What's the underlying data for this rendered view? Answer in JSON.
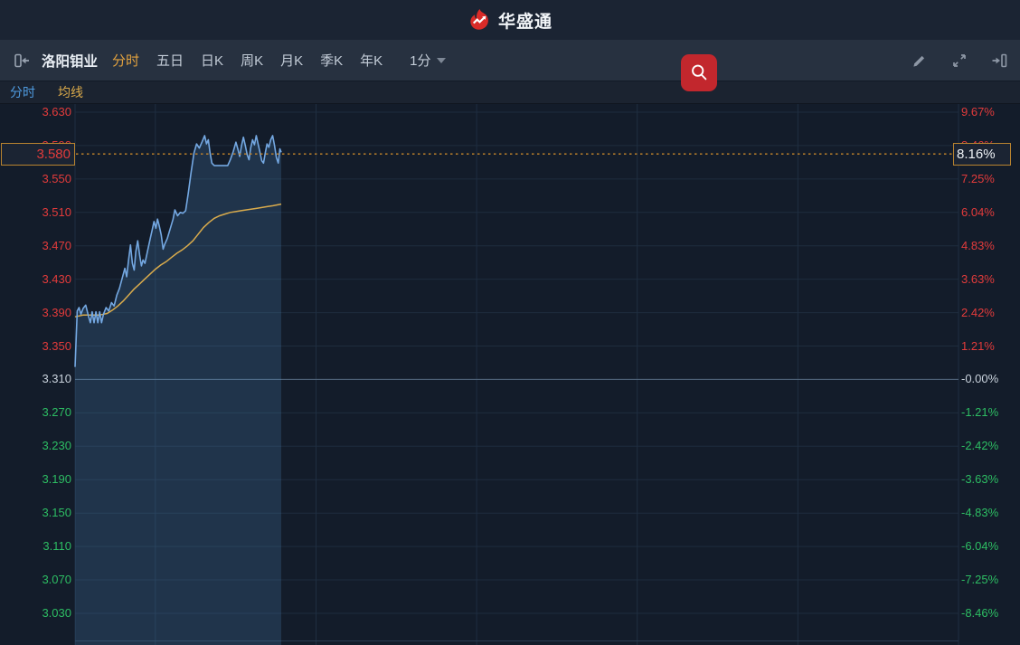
{
  "header": {
    "app_name": "华盛通"
  },
  "toolbar": {
    "stock_name": "洛阳钼业",
    "period_tabs": [
      {
        "label": "分时",
        "active": true
      },
      {
        "label": "五日",
        "active": false
      },
      {
        "label": "日K",
        "active": false
      },
      {
        "label": "周K",
        "active": false
      },
      {
        "label": "月K",
        "active": false
      },
      {
        "label": "季K",
        "active": false
      },
      {
        "label": "年K",
        "active": false
      }
    ],
    "interval_label": "1分",
    "icons": [
      "collapse-panel-icon",
      "search-icon",
      "draw-icon",
      "fullscreen-icon",
      "exit-panel-icon",
      "chevron-down-icon"
    ]
  },
  "subtabs": [
    {
      "label": "分时",
      "color": "#4f9be0"
    },
    {
      "label": "均线",
      "color": "#d9a94a"
    }
  ],
  "palette": {
    "up_red": "#e23b3b",
    "down_green": "#2dbd63",
    "neutral": "#c9d2dc",
    "accent_orange": "#e2a23f",
    "dotted_line": "#c8872b",
    "search_red": "#c2272d",
    "logo_red": "#d92b28"
  },
  "chart_data": {
    "type": "line",
    "title": "洛阳钼业 分时",
    "prev_close": 3.31,
    "current_price": 3.58,
    "current_price_label": "3.580",
    "current_change_label": "8.16%",
    "price_axis": {
      "max": 3.63,
      "min": 3.03,
      "step": 0.04
    },
    "time_axis": {
      "session_minutes": 330,
      "grid_minutes": [
        30,
        90,
        150,
        210,
        270,
        330
      ]
    },
    "y_axis_left": [
      "3.630",
      "3.590",
      "3.550",
      "3.510",
      "3.470",
      "3.430",
      "3.390",
      "3.350",
      "3.310",
      "3.270",
      "3.230",
      "3.190",
      "3.150",
      "3.110",
      "3.070",
      "3.030"
    ],
    "y_axis_right": [
      "9.67%",
      "8.46%",
      "7.25%",
      "6.04%",
      "4.83%",
      "3.63%",
      "2.42%",
      "1.21%",
      "-0.00%",
      "-1.21%",
      "-2.42%",
      "-3.63%",
      "-4.83%",
      "-6.04%",
      "-7.25%",
      "-8.46%"
    ],
    "legend": [
      "分时",
      "均线"
    ],
    "grid": true,
    "series": [
      {
        "name": "price",
        "color": "#74a8e2",
        "points": [
          [
            0,
            3.325
          ],
          [
            0.4,
            3.358
          ],
          [
            0.8,
            3.392
          ],
          [
            1.5,
            3.396
          ],
          [
            2.2,
            3.388
          ],
          [
            3,
            3.395
          ],
          [
            4,
            3.399
          ],
          [
            5,
            3.386
          ],
          [
            5.7,
            3.378
          ],
          [
            6.4,
            3.391
          ],
          [
            7.1,
            3.378
          ],
          [
            7.8,
            3.391
          ],
          [
            8.5,
            3.378
          ],
          [
            9.2,
            3.391
          ],
          [
            9.9,
            3.378
          ],
          [
            10.6,
            3.388
          ],
          [
            11.6,
            3.396
          ],
          [
            12.6,
            3.392
          ],
          [
            13.6,
            3.402
          ],
          [
            14.6,
            3.398
          ],
          [
            15.6,
            3.411
          ],
          [
            16.6,
            3.419
          ],
          [
            17.6,
            3.431
          ],
          [
            18.6,
            3.443
          ],
          [
            19.3,
            3.433
          ],
          [
            20,
            3.453
          ],
          [
            20.7,
            3.471
          ],
          [
            21.4,
            3.449
          ],
          [
            22.1,
            3.441
          ],
          [
            22.7,
            3.463
          ],
          [
            23.4,
            3.476
          ],
          [
            24.1,
            3.459
          ],
          [
            24.8,
            3.446
          ],
          [
            25.4,
            3.453
          ],
          [
            26.1,
            3.449
          ],
          [
            27.1,
            3.464
          ],
          [
            28.1,
            3.479
          ],
          [
            28.8,
            3.489
          ],
          [
            29.5,
            3.499
          ],
          [
            30.2,
            3.491
          ],
          [
            30.8,
            3.502
          ],
          [
            31.5,
            3.493
          ],
          [
            32.2,
            3.483
          ],
          [
            32.9,
            3.466
          ],
          [
            33.5,
            3.472
          ],
          [
            34.5,
            3.479
          ],
          [
            35.6,
            3.491
          ],
          [
            36.6,
            3.502
          ],
          [
            37.3,
            3.513
          ],
          [
            38.3,
            3.506
          ],
          [
            39.3,
            3.51
          ],
          [
            40.3,
            3.509
          ],
          [
            41.3,
            3.512
          ],
          [
            42.3,
            3.533
          ],
          [
            43.3,
            3.557
          ],
          [
            44.4,
            3.581
          ],
          [
            45.4,
            3.592
          ],
          [
            46.4,
            3.587
          ],
          [
            47.4,
            3.594
          ],
          [
            48.4,
            3.602
          ],
          [
            49.1,
            3.592
          ],
          [
            49.8,
            3.597
          ],
          [
            50.4,
            3.582
          ],
          [
            51.1,
            3.569
          ],
          [
            52,
            3.566
          ],
          [
            57,
            3.566
          ],
          [
            58,
            3.573
          ],
          [
            59.1,
            3.583
          ],
          [
            60.1,
            3.594
          ],
          [
            60.8,
            3.586
          ],
          [
            61.5,
            3.577
          ],
          [
            62.2,
            3.59
          ],
          [
            62.9,
            3.6
          ],
          [
            63.6,
            3.59
          ],
          [
            64.3,
            3.579
          ],
          [
            65,
            3.573
          ],
          [
            65.6,
            3.587
          ],
          [
            66.3,
            3.597
          ],
          [
            67,
            3.591
          ],
          [
            67.7,
            3.602
          ],
          [
            68.3,
            3.593
          ],
          [
            69,
            3.583
          ],
          [
            69.7,
            3.572
          ],
          [
            70.4,
            3.569
          ],
          [
            71.1,
            3.582
          ],
          [
            71.7,
            3.592
          ],
          [
            72.4,
            3.588
          ],
          [
            73.1,
            3.597
          ],
          [
            73.8,
            3.602
          ],
          [
            74.5,
            3.59
          ],
          [
            75.2,
            3.576
          ],
          [
            75.9,
            3.569
          ],
          [
            76.5,
            3.586
          ],
          [
            77,
            3.582
          ]
        ]
      },
      {
        "name": "avg",
        "color": "#d9ab4c",
        "points": [
          [
            0,
            3.385
          ],
          [
            3,
            3.387
          ],
          [
            6,
            3.387
          ],
          [
            9,
            3.387
          ],
          [
            12,
            3.389
          ],
          [
            14,
            3.393
          ],
          [
            16,
            3.398
          ],
          [
            18,
            3.404
          ],
          [
            20,
            3.411
          ],
          [
            22,
            3.418
          ],
          [
            24,
            3.424
          ],
          [
            26,
            3.43
          ],
          [
            28,
            3.436
          ],
          [
            30,
            3.442
          ],
          [
            32,
            3.447
          ],
          [
            34,
            3.451
          ],
          [
            36,
            3.456
          ],
          [
            38,
            3.461
          ],
          [
            40,
            3.465
          ],
          [
            42,
            3.47
          ],
          [
            44,
            3.476
          ],
          [
            46,
            3.484
          ],
          [
            48,
            3.492
          ],
          [
            50,
            3.498
          ],
          [
            52,
            3.503
          ],
          [
            54,
            3.506
          ],
          [
            56,
            3.508
          ],
          [
            58,
            3.51
          ],
          [
            60,
            3.511
          ],
          [
            62,
            3.512
          ],
          [
            64,
            3.513
          ],
          [
            66,
            3.514
          ],
          [
            68,
            3.515
          ],
          [
            70,
            3.516
          ],
          [
            72,
            3.517
          ],
          [
            74,
            3.518
          ],
          [
            77,
            3.52
          ]
        ]
      }
    ]
  }
}
